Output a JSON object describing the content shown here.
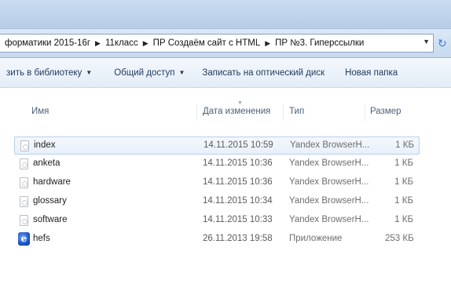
{
  "address": {
    "crumbs": [
      "форматики 2015-16г",
      "11класс",
      "ПР Создаём сайт с HTML",
      "ПР №3. Гиперссылки"
    ]
  },
  "toolbar": {
    "add_to_library": "зить в библиотеку",
    "share": "Общий доступ",
    "burn": "Записать на оптический диск",
    "new_folder": "Новая папка"
  },
  "columns": {
    "name": "Имя",
    "date": "Дата изменения",
    "type": "Тип",
    "size": "Размер"
  },
  "files": [
    {
      "name": "index",
      "date": "14.11.2015 10:59",
      "type": "Yandex BrowserH...",
      "size": "1 КБ",
      "icon": "html-file-icon",
      "selected": true
    },
    {
      "name": "anketa",
      "date": "14.11.2015 10:36",
      "type": "Yandex BrowserH...",
      "size": "1 КБ",
      "icon": "html-file-icon"
    },
    {
      "name": "hardware",
      "date": "14.11.2015 10:36",
      "type": "Yandex BrowserH...",
      "size": "1 КБ",
      "icon": "html-file-icon"
    },
    {
      "name": "glossary",
      "date": "14.11.2015 10:34",
      "type": "Yandex BrowserH...",
      "size": "1 КБ",
      "icon": "html-file-icon"
    },
    {
      "name": "software",
      "date": "14.11.2015 10:33",
      "type": "Yandex BrowserH...",
      "size": "1 КБ",
      "icon": "html-file-icon"
    },
    {
      "name": "hefs",
      "date": "26.11.2013 19:58",
      "type": "Приложение",
      "size": "253 КБ",
      "icon": "application-icon"
    }
  ]
}
